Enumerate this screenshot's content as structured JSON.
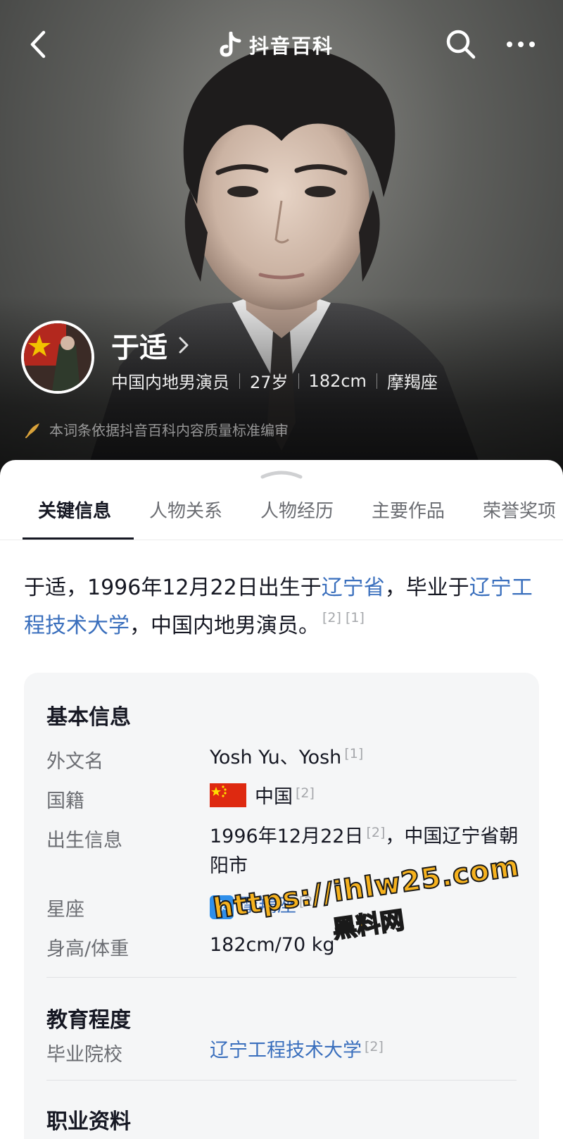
{
  "header": {
    "brand": "抖音百科"
  },
  "profile": {
    "name": "于适",
    "meta": [
      "中国内地男演员",
      "27岁",
      "182cm",
      "摩羯座"
    ]
  },
  "notice": "本词条依据抖音百科内容质量标准编审",
  "tabs": [
    {
      "label": "关键信息",
      "active": true
    },
    {
      "label": "人物关系",
      "active": false
    },
    {
      "label": "人物经历",
      "active": false
    },
    {
      "label": "主要作品",
      "active": false
    },
    {
      "label": "荣誉奖项",
      "active": false
    }
  ],
  "summary": {
    "p1": "于适，1996年12月22日出生于",
    "link1": "辽宁省",
    "p2": "，毕业于",
    "link2": "辽宁工程技术大学",
    "p3": "，中国内地男演员。",
    "refs": "[2] [1]"
  },
  "basic_info": {
    "title": "基本信息",
    "rows": [
      {
        "label": "外文名",
        "value": "Yosh Yu、Yosh",
        "ref": "[1]"
      },
      {
        "label": "国籍",
        "value": "中国",
        "ref": "[2]"
      },
      {
        "label": "出生信息",
        "value": "1996年12月22日",
        "ref": "[2]",
        "value_rest": "，中国辽宁省朝阳市"
      },
      {
        "label": "星座",
        "value": "摩羯座",
        "ref": "[2]",
        "badge": "♑"
      },
      {
        "label": "身高/体重",
        "value": "182cm/70 kg"
      }
    ]
  },
  "education": {
    "title": "教育程度",
    "rows": [
      {
        "label": "毕业院校",
        "value": "辽宁工程技术大学",
        "ref": "[2]"
      }
    ]
  },
  "career": {
    "title": "职业资料"
  },
  "watermark": {
    "line1": "https://ihlw25.com",
    "line2": "黑料网"
  },
  "colors": {
    "link": "#3a6fbd",
    "text_primary": "#161823",
    "text_secondary": "#6b6d72",
    "card_bg": "#f5f6f7",
    "watermark": "#f6b21e"
  }
}
